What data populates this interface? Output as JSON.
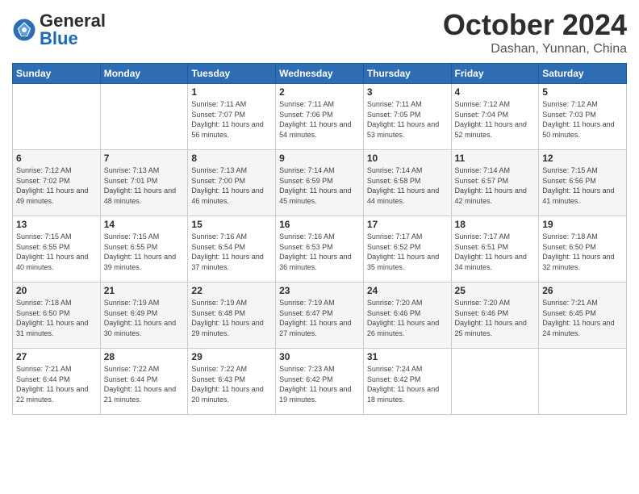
{
  "header": {
    "logo_general": "General",
    "logo_blue": "Blue",
    "month_title": "October 2024",
    "location": "Dashan, Yunnan, China"
  },
  "weekdays": [
    "Sunday",
    "Monday",
    "Tuesday",
    "Wednesday",
    "Thursday",
    "Friday",
    "Saturday"
  ],
  "weeks": [
    [
      {
        "day": "",
        "sunrise": "",
        "sunset": "",
        "daylight": ""
      },
      {
        "day": "",
        "sunrise": "",
        "sunset": "",
        "daylight": ""
      },
      {
        "day": "1",
        "sunrise": "Sunrise: 7:11 AM",
        "sunset": "Sunset: 7:07 PM",
        "daylight": "Daylight: 11 hours and 56 minutes."
      },
      {
        "day": "2",
        "sunrise": "Sunrise: 7:11 AM",
        "sunset": "Sunset: 7:06 PM",
        "daylight": "Daylight: 11 hours and 54 minutes."
      },
      {
        "day": "3",
        "sunrise": "Sunrise: 7:11 AM",
        "sunset": "Sunset: 7:05 PM",
        "daylight": "Daylight: 11 hours and 53 minutes."
      },
      {
        "day": "4",
        "sunrise": "Sunrise: 7:12 AM",
        "sunset": "Sunset: 7:04 PM",
        "daylight": "Daylight: 11 hours and 52 minutes."
      },
      {
        "day": "5",
        "sunrise": "Sunrise: 7:12 AM",
        "sunset": "Sunset: 7:03 PM",
        "daylight": "Daylight: 11 hours and 50 minutes."
      }
    ],
    [
      {
        "day": "6",
        "sunrise": "Sunrise: 7:12 AM",
        "sunset": "Sunset: 7:02 PM",
        "daylight": "Daylight: 11 hours and 49 minutes."
      },
      {
        "day": "7",
        "sunrise": "Sunrise: 7:13 AM",
        "sunset": "Sunset: 7:01 PM",
        "daylight": "Daylight: 11 hours and 48 minutes."
      },
      {
        "day": "8",
        "sunrise": "Sunrise: 7:13 AM",
        "sunset": "Sunset: 7:00 PM",
        "daylight": "Daylight: 11 hours and 46 minutes."
      },
      {
        "day": "9",
        "sunrise": "Sunrise: 7:14 AM",
        "sunset": "Sunset: 6:59 PM",
        "daylight": "Daylight: 11 hours and 45 minutes."
      },
      {
        "day": "10",
        "sunrise": "Sunrise: 7:14 AM",
        "sunset": "Sunset: 6:58 PM",
        "daylight": "Daylight: 11 hours and 44 minutes."
      },
      {
        "day": "11",
        "sunrise": "Sunrise: 7:14 AM",
        "sunset": "Sunset: 6:57 PM",
        "daylight": "Daylight: 11 hours and 42 minutes."
      },
      {
        "day": "12",
        "sunrise": "Sunrise: 7:15 AM",
        "sunset": "Sunset: 6:56 PM",
        "daylight": "Daylight: 11 hours and 41 minutes."
      }
    ],
    [
      {
        "day": "13",
        "sunrise": "Sunrise: 7:15 AM",
        "sunset": "Sunset: 6:55 PM",
        "daylight": "Daylight: 11 hours and 40 minutes."
      },
      {
        "day": "14",
        "sunrise": "Sunrise: 7:15 AM",
        "sunset": "Sunset: 6:55 PM",
        "daylight": "Daylight: 11 hours and 39 minutes."
      },
      {
        "day": "15",
        "sunrise": "Sunrise: 7:16 AM",
        "sunset": "Sunset: 6:54 PM",
        "daylight": "Daylight: 11 hours and 37 minutes."
      },
      {
        "day": "16",
        "sunrise": "Sunrise: 7:16 AM",
        "sunset": "Sunset: 6:53 PM",
        "daylight": "Daylight: 11 hours and 36 minutes."
      },
      {
        "day": "17",
        "sunrise": "Sunrise: 7:17 AM",
        "sunset": "Sunset: 6:52 PM",
        "daylight": "Daylight: 11 hours and 35 minutes."
      },
      {
        "day": "18",
        "sunrise": "Sunrise: 7:17 AM",
        "sunset": "Sunset: 6:51 PM",
        "daylight": "Daylight: 11 hours and 34 minutes."
      },
      {
        "day": "19",
        "sunrise": "Sunrise: 7:18 AM",
        "sunset": "Sunset: 6:50 PM",
        "daylight": "Daylight: 11 hours and 32 minutes."
      }
    ],
    [
      {
        "day": "20",
        "sunrise": "Sunrise: 7:18 AM",
        "sunset": "Sunset: 6:50 PM",
        "daylight": "Daylight: 11 hours and 31 minutes."
      },
      {
        "day": "21",
        "sunrise": "Sunrise: 7:19 AM",
        "sunset": "Sunset: 6:49 PM",
        "daylight": "Daylight: 11 hours and 30 minutes."
      },
      {
        "day": "22",
        "sunrise": "Sunrise: 7:19 AM",
        "sunset": "Sunset: 6:48 PM",
        "daylight": "Daylight: 11 hours and 29 minutes."
      },
      {
        "day": "23",
        "sunrise": "Sunrise: 7:19 AM",
        "sunset": "Sunset: 6:47 PM",
        "daylight": "Daylight: 11 hours and 27 minutes."
      },
      {
        "day": "24",
        "sunrise": "Sunrise: 7:20 AM",
        "sunset": "Sunset: 6:46 PM",
        "daylight": "Daylight: 11 hours and 26 minutes."
      },
      {
        "day": "25",
        "sunrise": "Sunrise: 7:20 AM",
        "sunset": "Sunset: 6:46 PM",
        "daylight": "Daylight: 11 hours and 25 minutes."
      },
      {
        "day": "26",
        "sunrise": "Sunrise: 7:21 AM",
        "sunset": "Sunset: 6:45 PM",
        "daylight": "Daylight: 11 hours and 24 minutes."
      }
    ],
    [
      {
        "day": "27",
        "sunrise": "Sunrise: 7:21 AM",
        "sunset": "Sunset: 6:44 PM",
        "daylight": "Daylight: 11 hours and 22 minutes."
      },
      {
        "day": "28",
        "sunrise": "Sunrise: 7:22 AM",
        "sunset": "Sunset: 6:44 PM",
        "daylight": "Daylight: 11 hours and 21 minutes."
      },
      {
        "day": "29",
        "sunrise": "Sunrise: 7:22 AM",
        "sunset": "Sunset: 6:43 PM",
        "daylight": "Daylight: 11 hours and 20 minutes."
      },
      {
        "day": "30",
        "sunrise": "Sunrise: 7:23 AM",
        "sunset": "Sunset: 6:42 PM",
        "daylight": "Daylight: 11 hours and 19 minutes."
      },
      {
        "day": "31",
        "sunrise": "Sunrise: 7:24 AM",
        "sunset": "Sunset: 6:42 PM",
        "daylight": "Daylight: 11 hours and 18 minutes."
      },
      {
        "day": "",
        "sunrise": "",
        "sunset": "",
        "daylight": ""
      },
      {
        "day": "",
        "sunrise": "",
        "sunset": "",
        "daylight": ""
      }
    ]
  ]
}
